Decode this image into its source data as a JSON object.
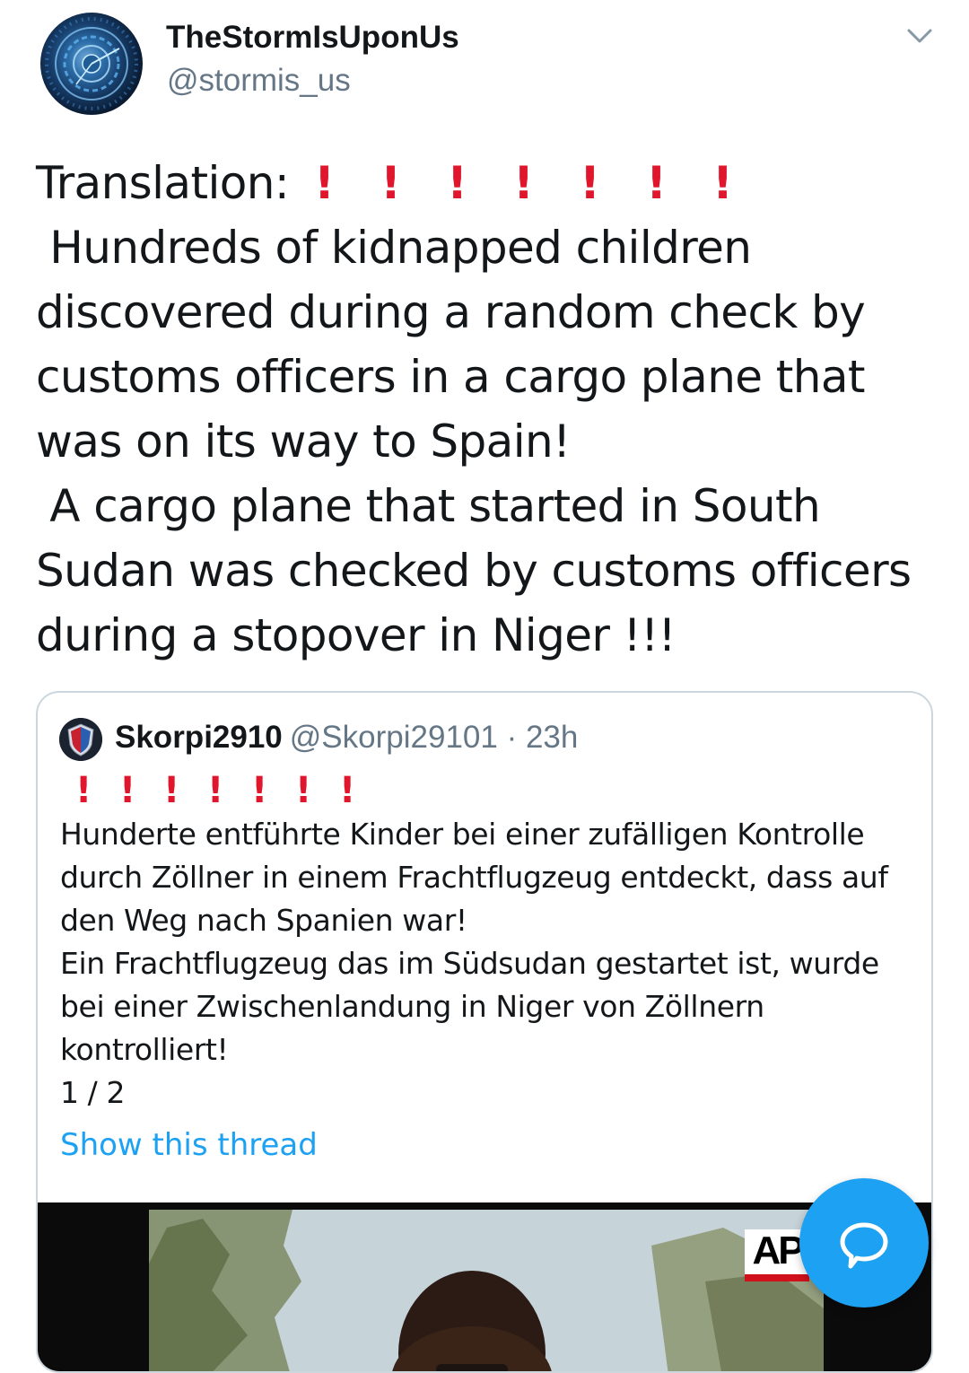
{
  "author": {
    "display_name": "TheStormIsUponUs",
    "handle": "@stormis_us"
  },
  "tweet": {
    "line1_prefix": "Translation:",
    "exclamations": [
      "!",
      "!",
      "!",
      "!",
      "!",
      "!",
      "!"
    ],
    "lines": [
      " Hundreds of kidnapped children",
      "discovered during a random check by",
      "customs officers in a cargo plane that",
      "was on its way to Spain!",
      " A cargo plane that started in South",
      "Sudan was checked by customs officers",
      "during a stopover in Niger !!!"
    ]
  },
  "quoted_tweet": {
    "display_name": "Skorpi2910",
    "handle_time": "@Skorpi29101 · 23h",
    "exclamations": [
      "!",
      "!",
      "!",
      "!",
      "!",
      "!",
      "!"
    ],
    "lines": [
      "Hunderte entführte Kinder bei einer zufälligen Kontrolle",
      "durch Zöllner in einem Frachtflugzeug entdeckt, dass auf",
      "den Weg nach Spanien war!",
      "Ein Frachtflugzeug das im Südsudan gestartet ist, wurde",
      "bei einer Zwischenlandung in Niger von Zöllnern",
      "kontrolliert!",
      "1 / 2"
    ],
    "show_thread_label": "Show this thread",
    "media": {
      "logo_text": "AP"
    }
  },
  "icons": {
    "menu": "chevron-down-icon",
    "compose": "speech-bubble-icon"
  },
  "colors": {
    "link": "#1da1f2",
    "exclamation": "#e0172c",
    "secondary_text": "#657786",
    "fab": "#1da1f2"
  }
}
